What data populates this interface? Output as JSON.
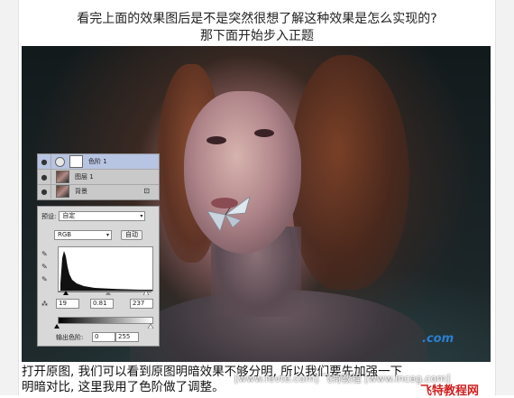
{
  "intro": {
    "line1": "看完上面的效果图后是不是突然很想了解这种效果是怎么实现的?",
    "line2": "那下面开始步入正题"
  },
  "layers_panel": {
    "layers": [
      {
        "name": "色阶 1",
        "selected": true
      },
      {
        "name": "图层 1",
        "selected": false
      },
      {
        "name": "背景",
        "selected": false,
        "locked": true
      }
    ]
  },
  "levels_panel": {
    "preset_label": "预设:",
    "preset_value": "自定",
    "channel_value": "RGB",
    "auto_label": "自动",
    "input_black": "19",
    "input_gamma": "0.81",
    "input_white": "237",
    "output_label": "输出色阶:",
    "output_black": "0",
    "output_white": "255"
  },
  "caption": {
    "line1": "打开原图, 我们可以看到原图明暗效果不够分明, 所以我们要先加强一下",
    "line2": "明暗对比, 这里我用了色阶做了调整。"
  },
  "watermark": {
    "url": "[www.fevte.com] 飞特教程 [www.lnceg.com]",
    "logo": ".com",
    "brand": "飞特教程网"
  }
}
